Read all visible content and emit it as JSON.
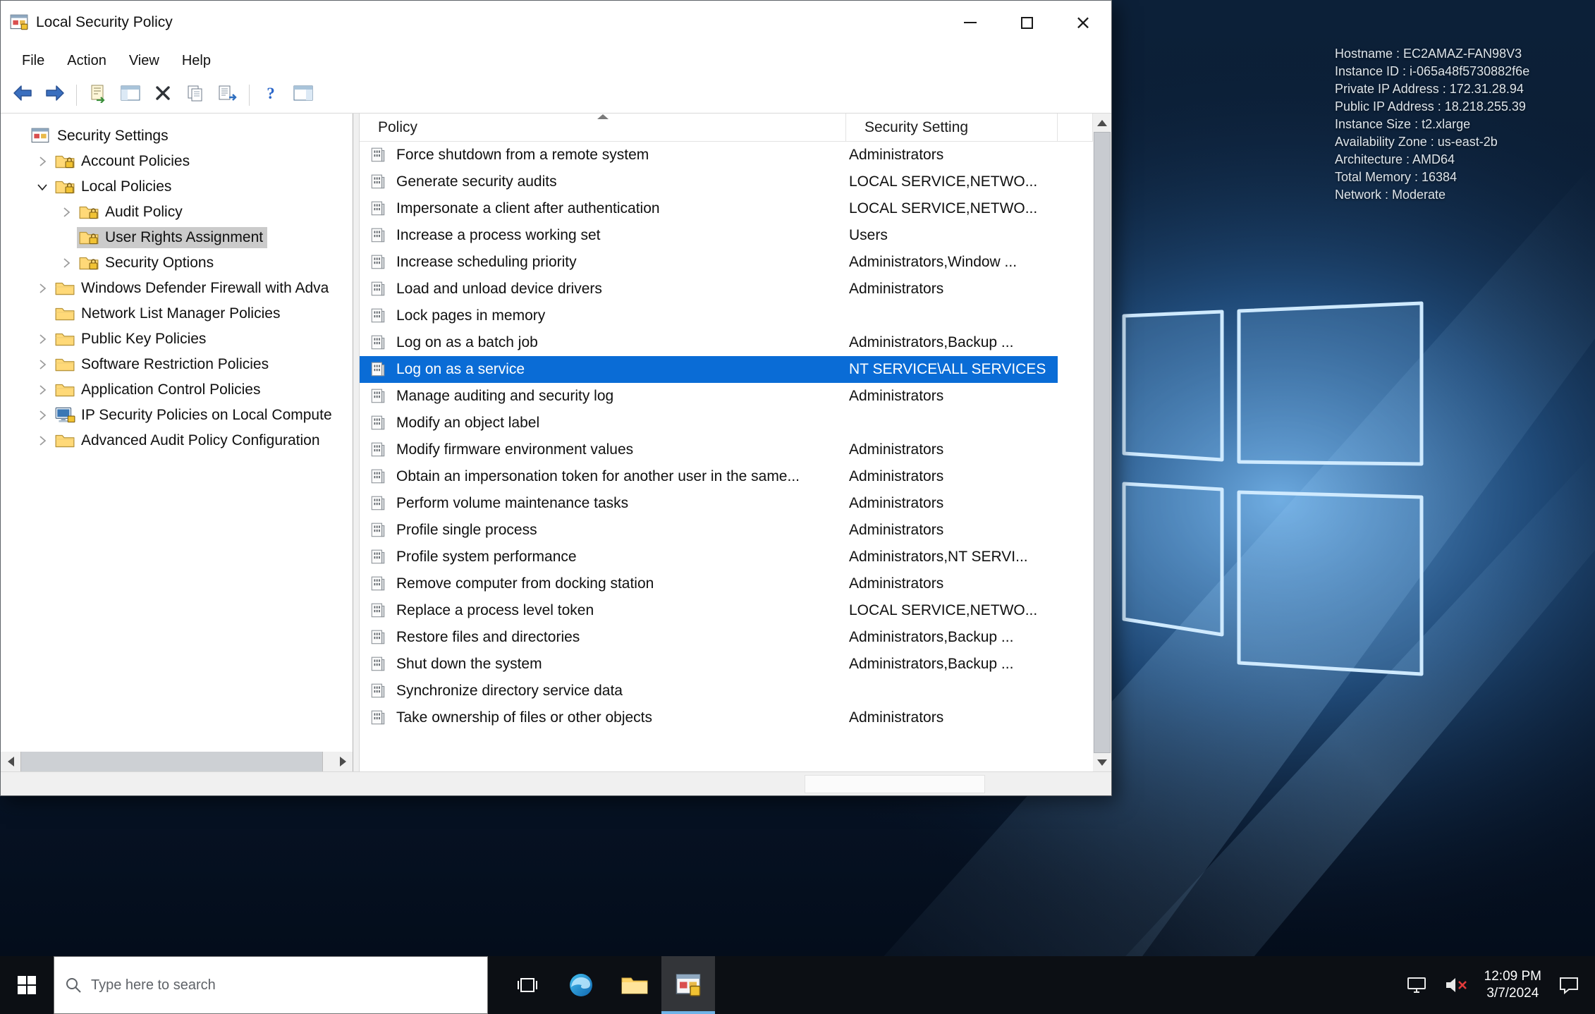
{
  "window": {
    "title": "Local Security Policy",
    "menu": [
      "File",
      "Action",
      "View",
      "Help"
    ],
    "toolbar_icons": [
      "back",
      "forward",
      "sep",
      "export",
      "console-tree",
      "delete",
      "properties",
      "export-list",
      "sep",
      "help",
      "action-pane"
    ],
    "tree": {
      "items": [
        {
          "label": "Security Settings",
          "level": 0,
          "icon": "console-root",
          "expander": "none",
          "selected": false
        },
        {
          "label": "Account Policies",
          "level": 1,
          "icon": "folder-lock",
          "expander": "collapsed",
          "selected": false
        },
        {
          "label": "Local Policies",
          "level": 1,
          "icon": "folder-lock",
          "expander": "expanded",
          "selected": false
        },
        {
          "label": "Audit Policy",
          "level": 2,
          "icon": "folder-lock",
          "expander": "collapsed",
          "selected": false
        },
        {
          "label": "User Rights Assignment",
          "level": 2,
          "icon": "folder-lock",
          "expander": "none",
          "selected": true
        },
        {
          "label": "Security Options",
          "level": 2,
          "icon": "folder-lock",
          "expander": "collapsed",
          "selected": false
        },
        {
          "label": "Windows Defender Firewall with Adva",
          "level": 1,
          "icon": "folder",
          "expander": "collapsed",
          "selected": false
        },
        {
          "label": "Network List Manager Policies",
          "level": 1,
          "icon": "folder",
          "expander": "none",
          "selected": false
        },
        {
          "label": "Public Key Policies",
          "level": 1,
          "icon": "folder",
          "expander": "collapsed",
          "selected": false
        },
        {
          "label": "Software Restriction Policies",
          "level": 1,
          "icon": "folder",
          "expander": "collapsed",
          "selected": false
        },
        {
          "label": "Application Control Policies",
          "level": 1,
          "icon": "folder",
          "expander": "collapsed",
          "selected": false
        },
        {
          "label": "IP Security Policies on Local Compute",
          "level": 1,
          "icon": "computer-lock",
          "expander": "collapsed",
          "selected": false
        },
        {
          "label": "Advanced Audit Policy Configuration",
          "level": 1,
          "icon": "folder",
          "expander": "collapsed",
          "selected": false
        }
      ]
    },
    "list": {
      "columns": [
        "Policy",
        "Security Setting"
      ],
      "rows": [
        {
          "policy": "Force shutdown from a remote system",
          "setting": "Administrators",
          "selected": false
        },
        {
          "policy": "Generate security audits",
          "setting": "LOCAL SERVICE,NETWO...",
          "selected": false
        },
        {
          "policy": "Impersonate a client after authentication",
          "setting": "LOCAL SERVICE,NETWO...",
          "selected": false
        },
        {
          "policy": "Increase a process working set",
          "setting": "Users",
          "selected": false
        },
        {
          "policy": "Increase scheduling priority",
          "setting": "Administrators,Window ...",
          "selected": false
        },
        {
          "policy": "Load and unload device drivers",
          "setting": "Administrators",
          "selected": false
        },
        {
          "policy": "Lock pages in memory",
          "setting": "",
          "selected": false
        },
        {
          "policy": "Log on as a batch job",
          "setting": "Administrators,Backup ...",
          "selected": false
        },
        {
          "policy": "Log on as a service",
          "setting": "NT SERVICE\\ALL SERVICES",
          "selected": true
        },
        {
          "policy": "Manage auditing and security log",
          "setting": "Administrators",
          "selected": false
        },
        {
          "policy": "Modify an object label",
          "setting": "",
          "selected": false
        },
        {
          "policy": "Modify firmware environment values",
          "setting": "Administrators",
          "selected": false
        },
        {
          "policy": "Obtain an impersonation token for another user in the same...",
          "setting": "Administrators",
          "selected": false
        },
        {
          "policy": "Perform volume maintenance tasks",
          "setting": "Administrators",
          "selected": false
        },
        {
          "policy": "Profile single process",
          "setting": "Administrators",
          "selected": false
        },
        {
          "policy": "Profile system performance",
          "setting": "Administrators,NT SERVI...",
          "selected": false
        },
        {
          "policy": "Remove computer from docking station",
          "setting": "Administrators",
          "selected": false
        },
        {
          "policy": "Replace a process level token",
          "setting": "LOCAL SERVICE,NETWO...",
          "selected": false
        },
        {
          "policy": "Restore files and directories",
          "setting": "Administrators,Backup ...",
          "selected": false
        },
        {
          "policy": "Shut down the system",
          "setting": "Administrators,Backup ...",
          "selected": false
        },
        {
          "policy": "Synchronize directory service data",
          "setting": "",
          "selected": false
        },
        {
          "policy": "Take ownership of files or other objects",
          "setting": "Administrators",
          "selected": false
        }
      ]
    }
  },
  "desktop_info": {
    "lines": [
      "Hostname : EC2AMAZ-FAN98V3",
      "Instance ID : i-065a48f5730882f6e",
      "Private IP Address : 172.31.28.94",
      "Public IP Address : 18.218.255.39",
      "Instance Size : t2.xlarge",
      "Availability Zone : us-east-2b",
      "Architecture : AMD64",
      "Total Memory : 16384",
      "Network : Moderate"
    ]
  },
  "taskbar": {
    "search_placeholder": "Type here to search",
    "clock": {
      "time": "12:09 PM",
      "date": "3/7/2024"
    }
  }
}
